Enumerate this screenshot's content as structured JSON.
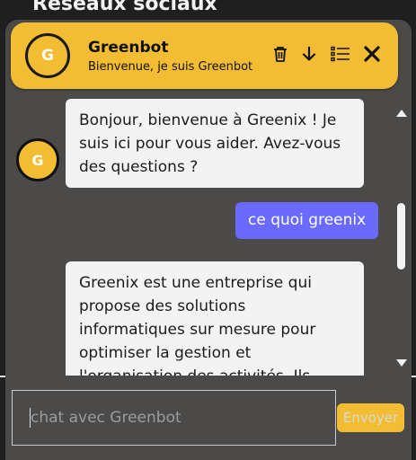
{
  "background": {
    "title": "Réseaux sociaux"
  },
  "header": {
    "avatar_letter": "G",
    "bot_name": "Greenbot",
    "subtitle": "Bienvenue, je suis Greenbot",
    "icons": [
      "trash-icon",
      "arrow-down-icon",
      "list-icon",
      "close-icon"
    ]
  },
  "messages": [
    {
      "sender": "bot",
      "avatar_letter": "G",
      "lines": [
        "Bonjour, bienvenue à Greenix ! Je",
        "suis ici pour vous aider. Avez-vous",
        "des questions ?"
      ]
    },
    {
      "sender": "user",
      "text": "ce quoi greenix"
    },
    {
      "sender": "bot",
      "lines": [
        "Greenix est une entreprise qui",
        "propose des solutions",
        "informatiques sur mesure pour",
        "optimiser la gestion et",
        "l'organisation des activités. Ils"
      ]
    }
  ],
  "composer": {
    "placeholder": "chat avec Greenbot",
    "send_label": "Envoyer"
  },
  "colors": {
    "accent": "#f2bd33",
    "panel": "#4b4a48",
    "user_bubble": "#6a6aff",
    "bot_bubble": "#f3f3f3"
  }
}
